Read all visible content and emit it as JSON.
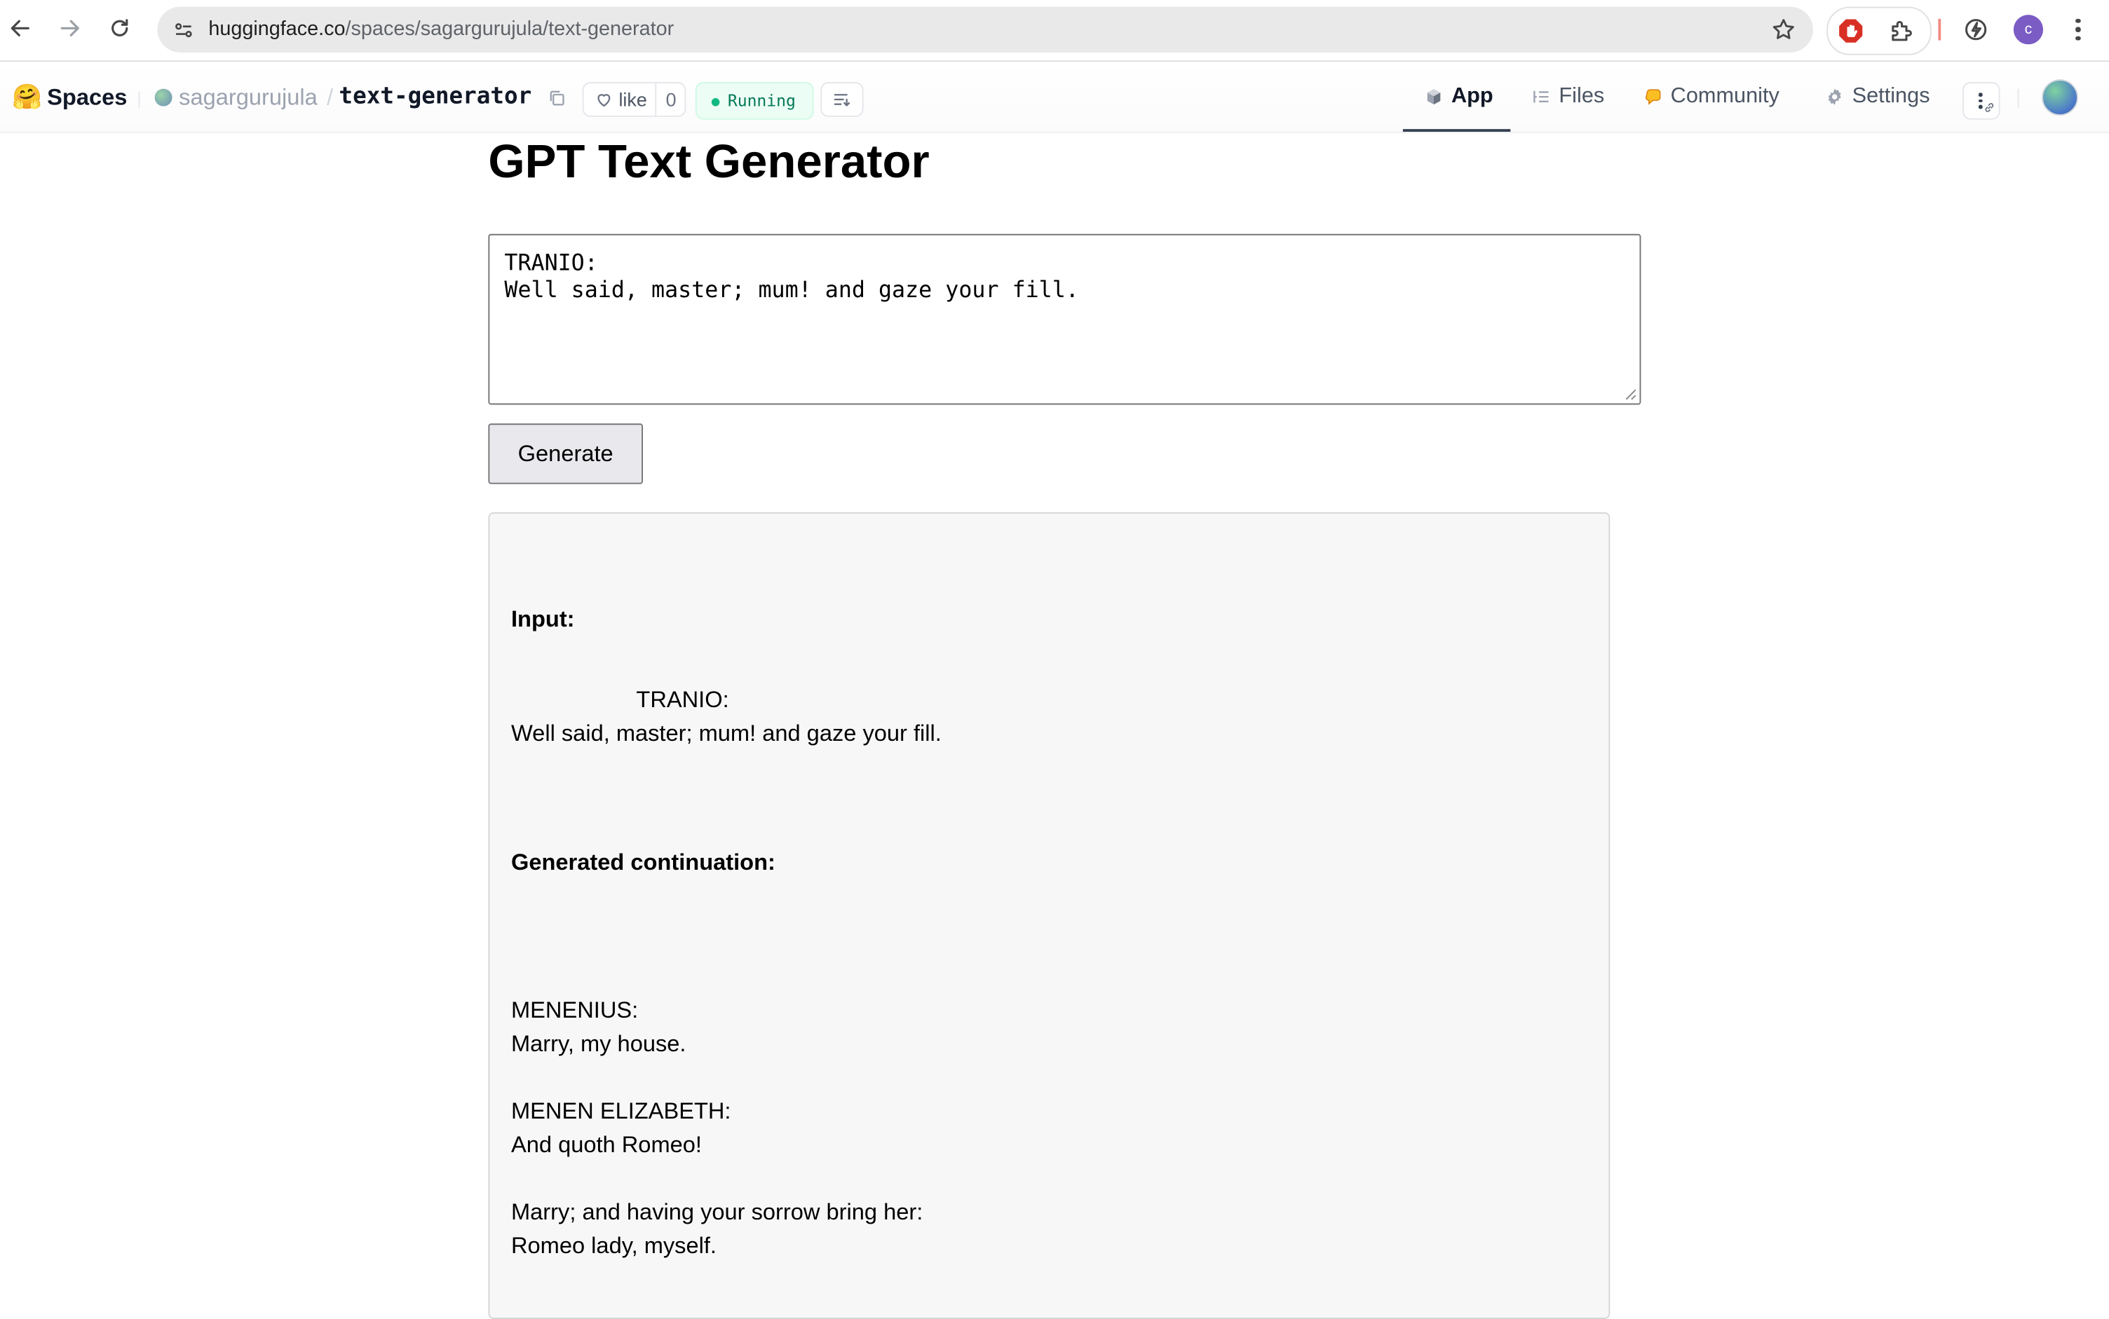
{
  "browser": {
    "url_host": "huggingface.co",
    "url_path": "/spaces/sagargurujula/text-generator",
    "profile_initial": "c"
  },
  "hf_header": {
    "logo_emoji": "🤗",
    "spaces_label": "Spaces",
    "owner": "sagargurujula",
    "separator": "/",
    "repo": "text-generator",
    "like_label": "like",
    "like_count": "0",
    "status": "Running",
    "tabs": [
      {
        "label": "App",
        "icon": "cube-icon",
        "active": true
      },
      {
        "label": "Files",
        "icon": "files-icon",
        "active": false
      },
      {
        "label": "Community",
        "icon": "community-icon",
        "active": false
      },
      {
        "label": "Settings",
        "icon": "gear-icon",
        "active": false
      }
    ]
  },
  "app": {
    "title": "GPT Text Generator",
    "prompt_value": "TRANIO:\nWell said, master; mum! and gaze your fill.",
    "generate_label": "Generate",
    "output": {
      "input_heading": "Input:",
      "input_line1": "TRANIO:",
      "input_line2": "Well said, master; mum! and gaze your fill.",
      "generated_heading": "Generated continuation:",
      "generated_text": "MENENIUS:\nMarry, my house.\n\nMENEN ELIZABETH:\nAnd quoth Romeo!\n\nMarry; and having your sorrow bring her:\nRomeo lady, myself."
    }
  },
  "colors": {
    "running_green": "#10b981",
    "accent_ext_red": "#d93025",
    "profile_purple": "#7b5cc4"
  }
}
